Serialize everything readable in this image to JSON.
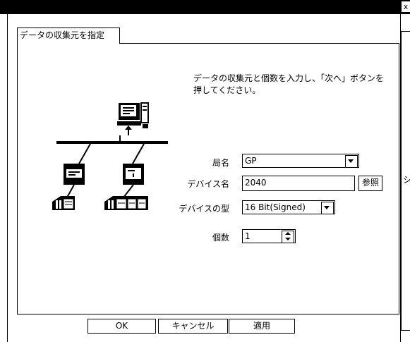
{
  "window": {
    "title": "",
    "close_label": "x"
  },
  "tab": {
    "label": "データの収集元を指定"
  },
  "instruction": "データの収集元と個数を入力し、「次へ」ボタンを押してください。",
  "form": {
    "station_label": "局名",
    "station_value": "GP",
    "device_label": "デバイス名",
    "device_value": "2040",
    "browse_label": "参照",
    "type_label": "デバイスの型",
    "type_value": "16 Bit(Signed)",
    "count_label": "個数",
    "count_value": "1"
  },
  "buttons": {
    "ok": "OK",
    "cancel": "キャンセル",
    "apply": "適用"
  },
  "right_panel_glyph": "シ"
}
